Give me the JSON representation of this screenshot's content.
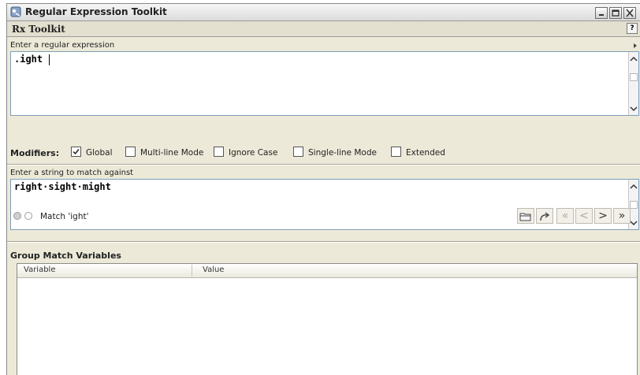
{
  "window": {
    "title": "Regular Expression Toolkit",
    "controls": [
      "minimize-icon",
      "maximize-icon",
      "close-icon"
    ]
  },
  "header": {
    "title": "Rx Toolkit",
    "help_label": "?"
  },
  "regex": {
    "label": "Enter a regular expression",
    "value": ".ight"
  },
  "modifiers": {
    "label": "Modifiers:",
    "items": [
      {
        "label": "Global",
        "checked": true
      },
      {
        "label": "Multi-line Mode",
        "checked": false
      },
      {
        "label": "Ignore Case",
        "checked": false
      },
      {
        "label": "Single-line Mode",
        "checked": false
      },
      {
        "label": "Extended",
        "checked": false
      }
    ]
  },
  "target": {
    "label": "Enter a string to match against",
    "value": "right·sight·might"
  },
  "status": {
    "text": "Match 'ight'"
  },
  "toolbar": {
    "buttons": [
      "open-icon",
      "redo-icon",
      "first-icon",
      "prev-icon",
      "next-icon",
      "last-icon"
    ],
    "first_label": "«",
    "prev_label": "<",
    "next_label": ">",
    "last_label": "»"
  },
  "groups": {
    "title": "Group Match Variables",
    "columns": [
      "Variable",
      "Value"
    ],
    "rows": []
  },
  "colors": {
    "chrome": "#ece9d8",
    "field_border": "#7f9db9"
  }
}
